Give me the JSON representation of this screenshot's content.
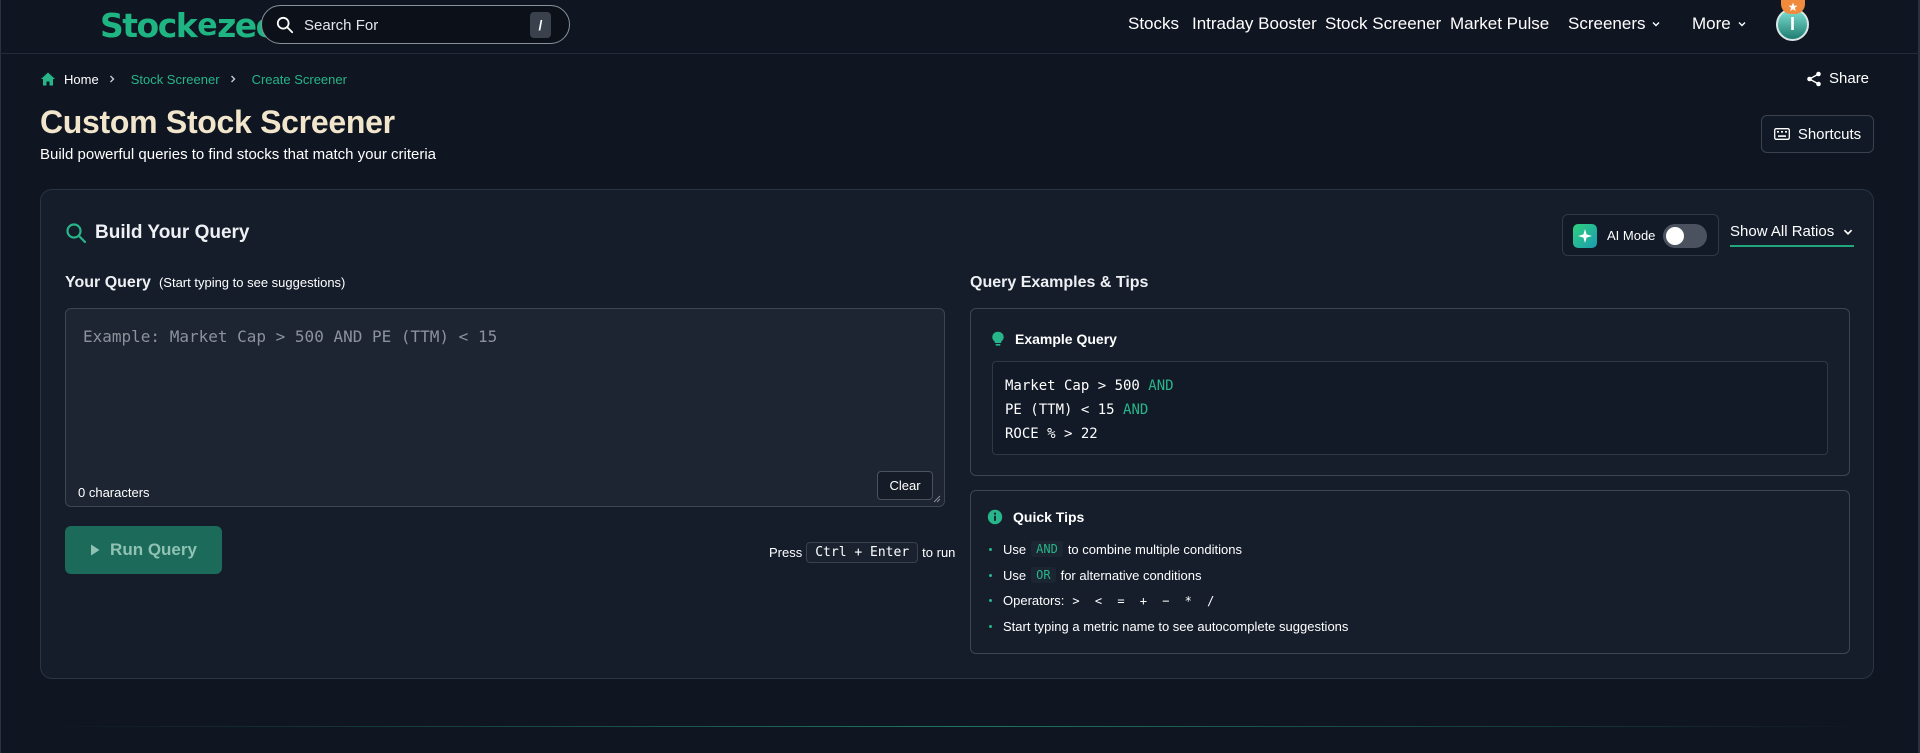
{
  "brand": {
    "name_left": "Stock",
    "name_right": "zee",
    "bolt_glyph": "e",
    "color": "#1fb583"
  },
  "search": {
    "placeholder": "Search For",
    "shortcut": "/"
  },
  "nav": {
    "items": [
      "Stocks",
      "Intraday Booster",
      "Stock Screener",
      "Market Pulse"
    ],
    "screeners": "Screeners",
    "more": "More"
  },
  "user": {
    "avatar_letter": "I"
  },
  "breadcrumb": {
    "home": "Home",
    "items": [
      "Stock Screener",
      "Create Screener"
    ]
  },
  "header": {
    "share": "Share",
    "title": "Custom Stock Screener",
    "subtitle": "Build powerful queries to find stocks that match your criteria",
    "shortcuts": "Shortcuts"
  },
  "builder": {
    "title": "Build Your Query",
    "ai_mode": "AI Mode",
    "ai_mode_enabled": false,
    "ratios": "Show All Ratios",
    "query_label": "Your Query",
    "query_hint": "(Start typing to see suggestions)",
    "placeholder": "Example: Market Cap > 500 AND PE (TTM) < 15",
    "char_count": "0 characters",
    "clear": "Clear",
    "run": "Run Query",
    "press": "Press",
    "keys": "Ctrl + Enter",
    "to_run": "to run"
  },
  "tips": {
    "title": "Query Examples & Tips",
    "example_title": "Example Query",
    "example_lines": [
      {
        "expr": "Market Cap > 500",
        "op": "AND"
      },
      {
        "expr": "PE (TTM) < 15",
        "op": "AND"
      },
      {
        "expr": "ROCE % > 22",
        "op": ""
      }
    ],
    "quick_title": "Quick Tips",
    "rows": [
      {
        "pre": "Use",
        "code": "AND",
        "post": "to combine multiple conditions"
      },
      {
        "pre": "Use",
        "code": "OR",
        "post": "for alternative conditions"
      },
      {
        "pre": "Operators:",
        "ops": "> < = + − * /"
      },
      {
        "pre": "Start typing a metric name to see autocomplete suggestions"
      }
    ]
  },
  "colors": {
    "accent": "#27b589",
    "background": "#0f1521",
    "title": "#f1e6cc"
  }
}
